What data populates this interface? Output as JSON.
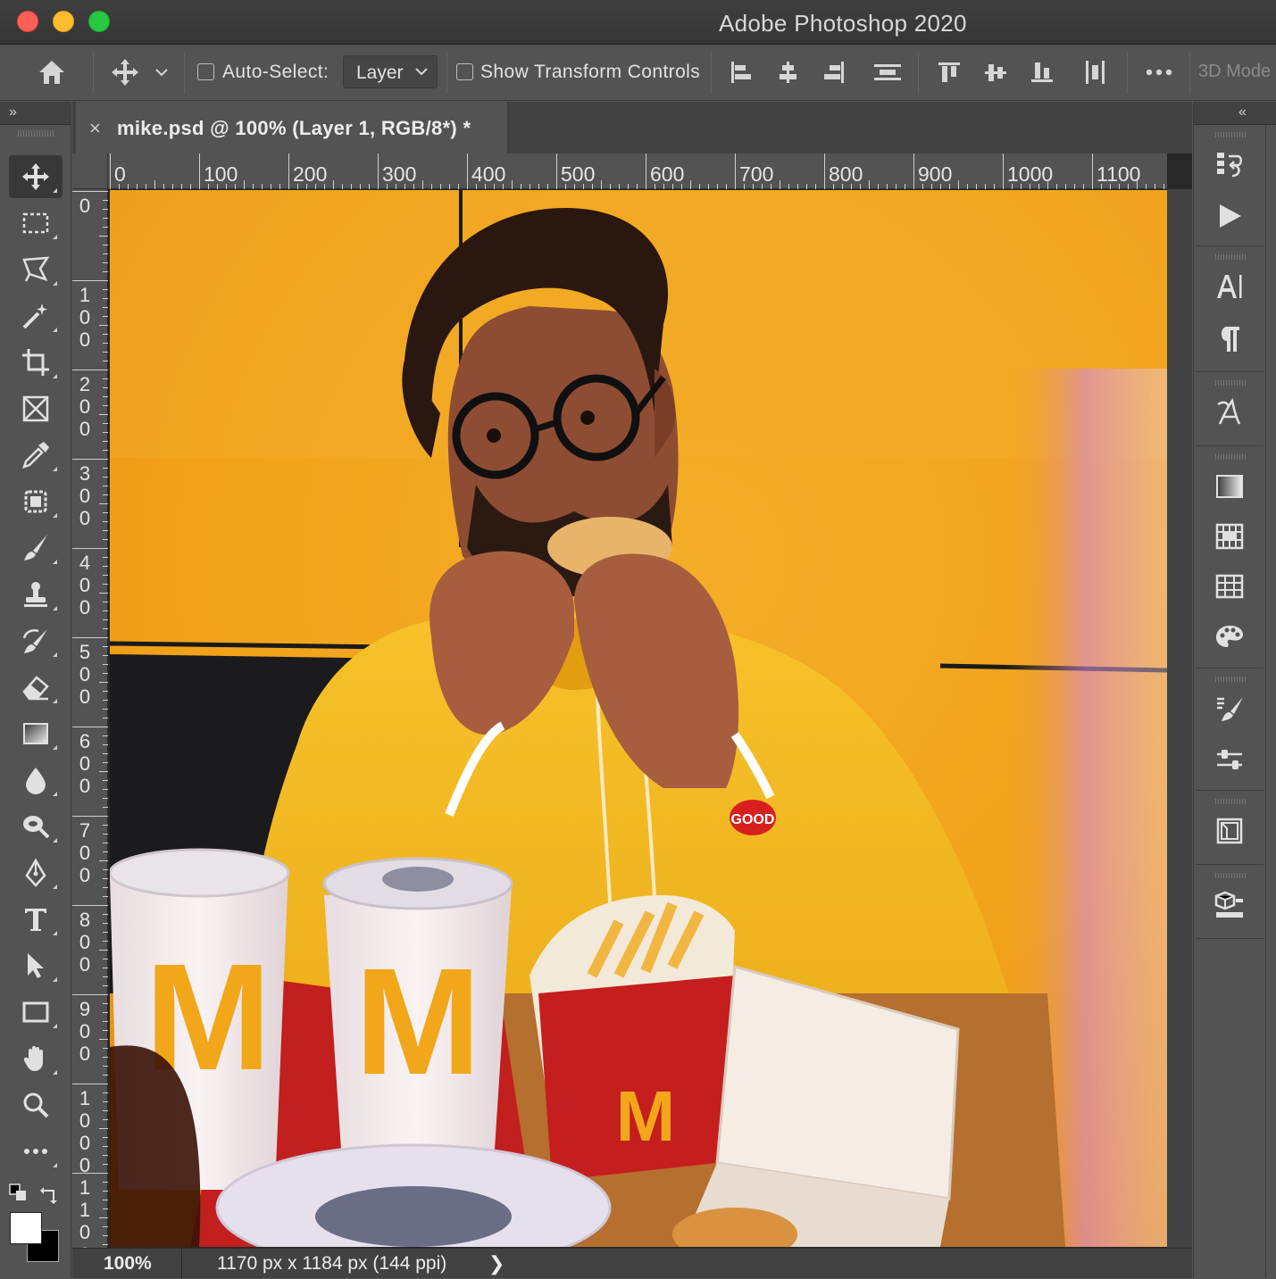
{
  "app": {
    "title": "Adobe Photoshop 2020"
  },
  "options_bar": {
    "auto_select_label": "Auto-Select:",
    "auto_select_target": "Layer",
    "show_transform_label": "Show Transform Controls",
    "mode_3d_label": "3D Mode"
  },
  "toolbar": {
    "collapse_label": "»",
    "tools": [
      "move-tool",
      "rectangular-marquee-tool",
      "polygonal-lasso-tool",
      "magic-wand-tool",
      "crop-tool",
      "frame-tool",
      "eyedropper-tool",
      "patch-tool",
      "brush-tool",
      "clone-stamp-tool",
      "history-brush-tool",
      "eraser-tool",
      "gradient-tool",
      "blur-tool",
      "dodge-tool",
      "pen-tool",
      "type-tool",
      "path-selection-tool",
      "rectangle-tool",
      "hand-tool",
      "zoom-tool",
      "more-tools"
    ],
    "active_tool": "move-tool",
    "foreground_color": "#ffffff",
    "background_color": "#000000"
  },
  "document": {
    "tab_close": "×",
    "tab_title": "mike.psd @ 100% (Layer 1, RGB/8*) *",
    "zoom": "100%",
    "info": "1170 px x 1184 px (144 ppi)",
    "status_arrow": "❯"
  },
  "rulers": {
    "horizontal": [
      "0",
      "100",
      "200",
      "300",
      "400",
      "500",
      "600",
      "700",
      "800",
      "900",
      "1000",
      "1100"
    ],
    "vertical": [
      "0",
      "100",
      "200",
      "300",
      "400",
      "500",
      "600",
      "700",
      "800",
      "900",
      "1000",
      "1100"
    ]
  },
  "right_dock": {
    "collapse_label": "«",
    "panels": [
      "history-icon",
      "actions-play-icon",
      "character-icon",
      "paragraph-icon",
      "glyphs-icon",
      "gradients-icon",
      "patterns-icon",
      "swatches-icon",
      "color-icon",
      "brush-settings-icon",
      "adjustments-icon",
      "libraries-icon",
      "3d-icon"
    ]
  },
  "colors": {
    "accent": "#f5a623",
    "panel": "#535353",
    "dark": "#282828"
  }
}
